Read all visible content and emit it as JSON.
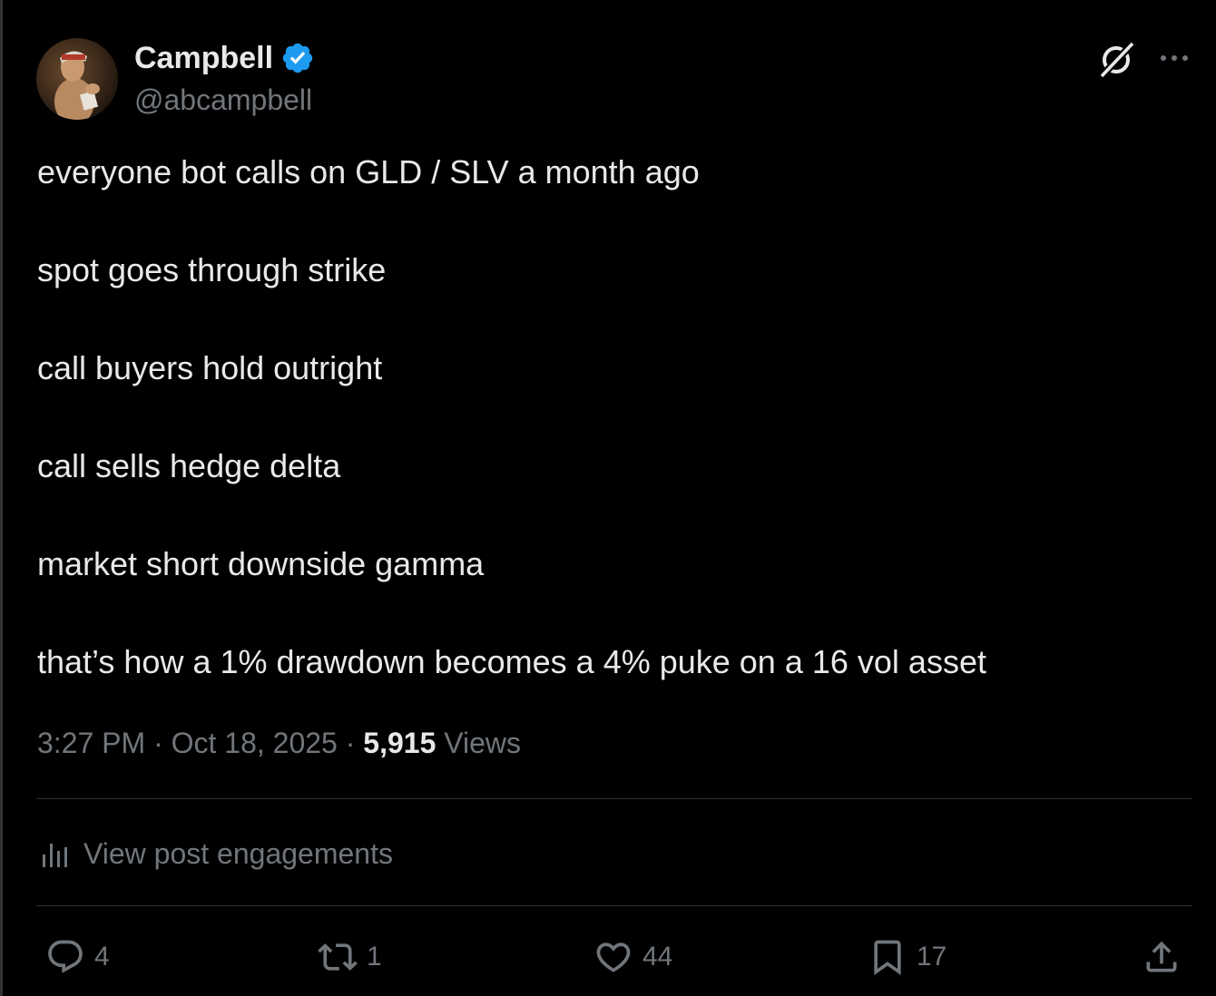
{
  "author": {
    "display_name": "Campbell",
    "handle": "@abcampbell",
    "verified": true
  },
  "tweet_lines": [
    "everyone bot calls on GLD / SLV a month ago",
    "spot goes through strike",
    "call buyers hold outright",
    "call sells hedge delta",
    "market short downside gamma",
    "that’s how a 1% drawdown becomes a 4% puke on a 16 vol asset"
  ],
  "meta": {
    "time": "3:27 PM",
    "separator": "·",
    "date": "Oct 18, 2025",
    "views_count": "5,915",
    "views_label": "Views"
  },
  "engagements_label": "View post engagements",
  "actions": {
    "replies": "4",
    "reposts": "1",
    "likes": "44",
    "bookmarks": "17"
  },
  "colors": {
    "background": "#000000",
    "text": "#e7e9ea",
    "muted": "#71767b",
    "divider": "#2f3336",
    "verified": "#1d9bf0"
  },
  "icons": [
    "verified-badge-icon",
    "grok-icon",
    "more-icon",
    "analytics-icon",
    "reply-icon",
    "repost-icon",
    "like-icon",
    "bookmark-icon",
    "share-icon"
  ]
}
